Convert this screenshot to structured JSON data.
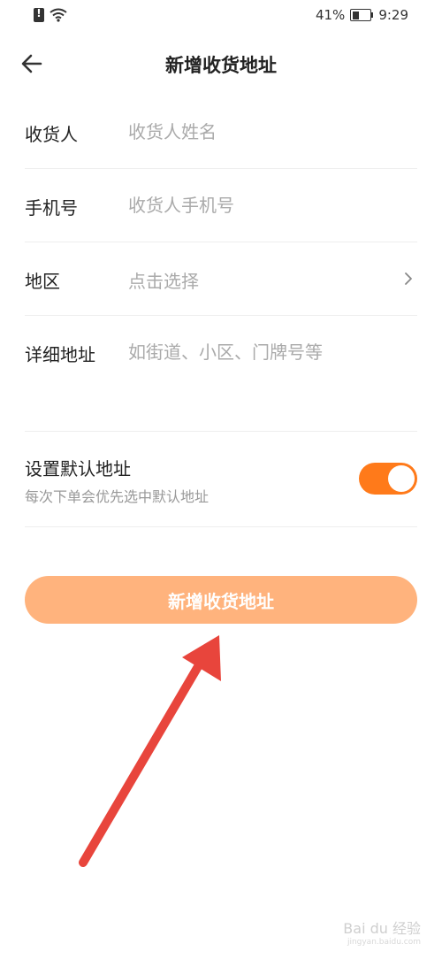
{
  "status_bar": {
    "battery_text": "41%",
    "battery_level": 0.41,
    "time": "9:29",
    "icons": [
      "sim-alert-icon",
      "wifi-icon",
      "battery-icon"
    ]
  },
  "header": {
    "title": "新增收货地址",
    "back_icon": "back-arrow-icon"
  },
  "form": {
    "name": {
      "label": "收货人",
      "placeholder": "收货人姓名",
      "value": ""
    },
    "phone": {
      "label": "手机号",
      "placeholder": "收货人手机号",
      "value": ""
    },
    "region": {
      "label": "地区",
      "placeholder": "点击选择",
      "icon": "chevron-right-icon"
    },
    "address": {
      "label": "详细地址",
      "placeholder": "如街道、小区、门牌号等",
      "value": ""
    }
  },
  "default_address": {
    "title": "设置默认地址",
    "subtitle": "每次下单会优先选中默认地址",
    "enabled": true
  },
  "submit_button": {
    "label": "新增收货地址"
  },
  "annotation": {
    "color": "#e8453c",
    "icon": "red-arrow-annotation"
  },
  "watermark": {
    "text": "Bai du 经验",
    "sub": "jingyan.baidu.com"
  },
  "colors": {
    "accent": "#ff7a1a",
    "button_bg": "#ffb37d",
    "placeholder": "#aaaaaa",
    "divider": "#eeeeee"
  }
}
